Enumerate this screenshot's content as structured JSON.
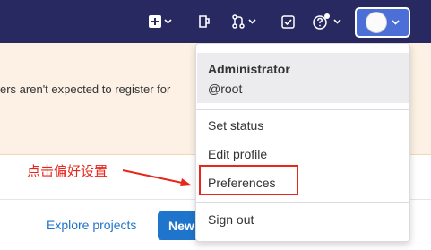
{
  "colors": {
    "topbar": "#292961",
    "banner": "#fcf1e4",
    "link": "#1f75cb",
    "annotation": "#e8271c",
    "user_button": "#4b6fd6"
  },
  "topbar": {
    "icons": [
      "plus-square-icon",
      "todo-icon",
      "merge-request-icon",
      "checkbox-icon",
      "help-icon"
    ]
  },
  "banner": {
    "text": "ers aren't expected to register for"
  },
  "annotation": {
    "text": "点击偏好设置"
  },
  "main": {
    "explore_link": "Explore projects",
    "new_button": "New"
  },
  "user_menu": {
    "name": "Administrator",
    "username": "@root",
    "items": [
      "Set status",
      "Edit profile",
      "Preferences",
      "Sign out"
    ]
  }
}
